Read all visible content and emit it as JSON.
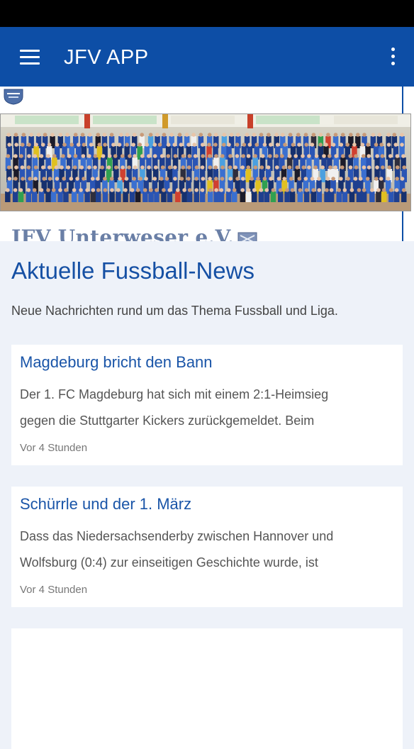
{
  "app": {
    "title": "JFV APP"
  },
  "header": {
    "club_name": "JFV Unterweser e.V."
  },
  "news": {
    "heading": "Aktuelle Fussball-News",
    "subheading": "Neue Nachrichten rund um das Thema Fussball und Liga.",
    "items": [
      {
        "title": "Magdeburg bricht den Bann",
        "line1": "Der 1. FC Magdeburg hat sich mit einem 2:1-Heimsieg",
        "line2": "gegen die Stuttgarter Kickers zurückgemeldet. Beim",
        "time": "Vor 4 Stunden"
      },
      {
        "title": "Schürrle und der 1. März",
        "line1": "Dass das Niedersachsenderby zwischen Hannover und",
        "line2": "Wolfsburg (0:4) zur einseitigen Geschichte wurde, ist",
        "time": "Vor 4 Stunden"
      }
    ]
  },
  "colors": {
    "primary": "#0d4ea6",
    "background": "#eef2f9",
    "card": "#ffffff",
    "link": "#1a55a8"
  },
  "icons": {
    "menu": "hamburger-menu-icon",
    "more": "more-vertical-icon"
  }
}
